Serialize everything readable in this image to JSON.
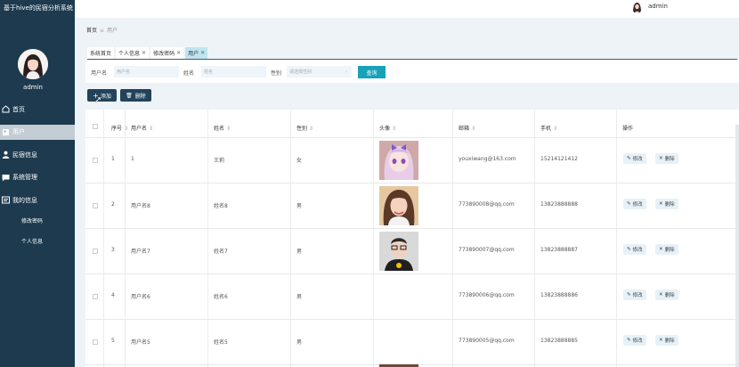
{
  "brand": {
    "title": "基于hive的民宿分析系统"
  },
  "sidebar": {
    "username": "admin",
    "menu": [
      {
        "label": "首页",
        "icon": "home-icon"
      },
      {
        "label": "用户",
        "icon": "user-card-icon",
        "active": true
      },
      {
        "label": "民宿信息",
        "icon": "person-icon"
      },
      {
        "label": "系统管理",
        "icon": "chat-icon"
      },
      {
        "label": "我的信息",
        "icon": "profile-icon"
      }
    ],
    "submenu": [
      {
        "label": "修改密码"
      },
      {
        "label": "个人信息"
      }
    ]
  },
  "header": {
    "username": "admin"
  },
  "breadcrumb": {
    "home": "首页",
    "separator": "≡",
    "current": "用户"
  },
  "tabs": [
    {
      "label": "系统首页",
      "closable": false
    },
    {
      "label": "个人信息",
      "closable": true
    },
    {
      "label": "修改密码",
      "closable": true
    },
    {
      "label": "用户",
      "closable": true,
      "active": true
    }
  ],
  "search": {
    "username_label": "用户名",
    "username_placeholder": "用户名",
    "name_label": "姓名",
    "name_placeholder": "姓名",
    "gender_label": "性别",
    "gender_placeholder": "请选择性别",
    "query_button": "查询"
  },
  "toolbar": {
    "add_label": "添加",
    "delete_label": "删除"
  },
  "table": {
    "columns": [
      "序号",
      "用户名",
      "姓名",
      "性别",
      "头像",
      "邮箱",
      "手机",
      "操作"
    ],
    "rows": [
      {
        "no": "1",
        "username": "1",
        "name": "王莉",
        "gender": "女",
        "photo": "anime",
        "email": "youxiwang@163.com",
        "phone": "15214121412"
      },
      {
        "no": "2",
        "username": "用户名8",
        "name": "姓名8",
        "gender": "男",
        "photo": "girl",
        "email": "773890008@qq.com",
        "phone": "13823888888"
      },
      {
        "no": "3",
        "username": "用户名7",
        "name": "姓名7",
        "gender": "男",
        "photo": "man",
        "email": "773890007@qq.com",
        "phone": "13823888887"
      },
      {
        "no": "4",
        "username": "用户名6",
        "name": "姓名6",
        "gender": "男",
        "photo": "",
        "email": "773890006@qq.com",
        "phone": "13823888886"
      },
      {
        "no": "5",
        "username": "用户名5",
        "name": "姓名5",
        "gender": "男",
        "photo": "",
        "email": "773890005@qq.com",
        "phone": "13823888885"
      }
    ],
    "edit_label": "修改",
    "delete_label": "删除"
  },
  "colors": {
    "sidebar": "#1d3a4e",
    "accent": "#17a2b8",
    "dark_button": "#22435a",
    "active_tab": "#bfe4f2"
  }
}
